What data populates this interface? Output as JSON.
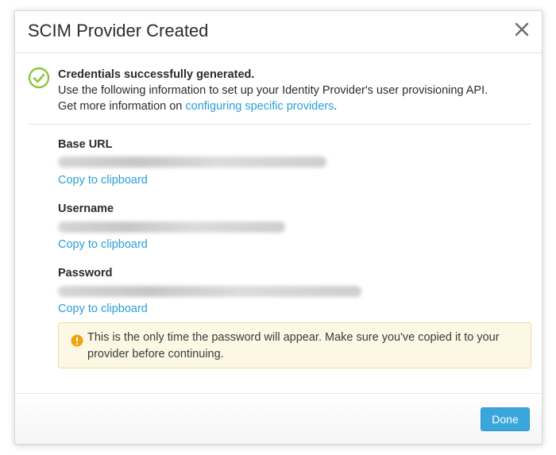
{
  "modal": {
    "title": "SCIM Provider Created",
    "close_icon": "close-icon"
  },
  "success": {
    "icon": "check-circle-icon",
    "icon_color": "#8cc63f",
    "title": "Credentials successfully generated.",
    "line1": "Use the following information to set up your Identity Provider's user provisioning API.",
    "line2_prefix": "Get more information on ",
    "line2_link": "configuring specific providers",
    "line2_suffix": "."
  },
  "fields": [
    {
      "label": "Base URL",
      "value": "",
      "copy_label": "Copy to clipboard"
    },
    {
      "label": "Username",
      "value": "",
      "copy_label": "Copy to clipboard"
    },
    {
      "label": "Password",
      "value": "",
      "copy_label": "Copy to clipboard"
    }
  ],
  "warning": {
    "icon": "warning-icon",
    "icon_color": "#f0a30a",
    "text": "This is the only time the password will appear. Make sure you've copied it to your provider before continuing."
  },
  "footer": {
    "done_label": "Done"
  },
  "colors": {
    "link": "#2a9fd6",
    "primary_button": "#3aa7dc",
    "warning_bg": "#fdf8e4"
  }
}
